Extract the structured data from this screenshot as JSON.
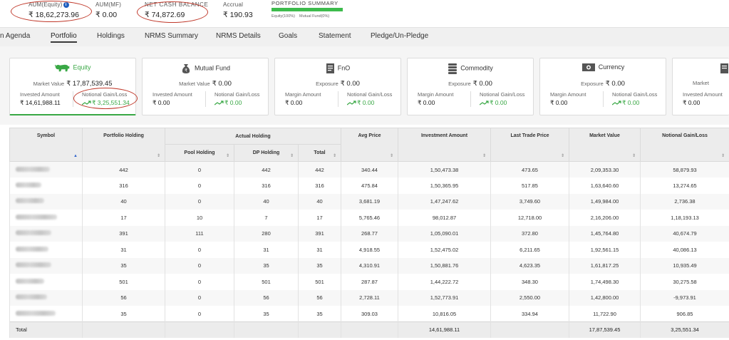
{
  "summary": {
    "aum_equity": {
      "label": "AUM(Equity)",
      "value": "₹ 18,62,273.96"
    },
    "aum_mf": {
      "label": "AUM(MF)",
      "value": "₹ 0.00"
    },
    "net_cash": {
      "label": "NET CASH BALANCE",
      "value": "₹ 74,872.69"
    },
    "accrual": {
      "label": "Accrual",
      "value": "₹ 190.93"
    },
    "portfolio_summary": {
      "title": "PORTFOLIO SUMMARY",
      "equity_pct": 100,
      "legend_equity": "Equity(100%)",
      "legend_mf": "Mutual Fund(0%)",
      "colors": {
        "equity": "#3dbb4c",
        "track": "#e5e5e5"
      }
    }
  },
  "nav": {
    "tabs": [
      "n Agenda",
      "Portfolio",
      "Holdings",
      "NRMS Summary",
      "NRMS Details",
      "Goals",
      "Statement",
      "Pledge/Un-Pledge"
    ],
    "active": "Portfolio"
  },
  "cards": [
    {
      "name": "Equity",
      "icon": "bull-icon",
      "sub_label": "Market Value",
      "sub_value": "₹ 17,87,539.45",
      "left_label": "Invested Amount",
      "left_value": "₹ 14,61,988.11",
      "right_label": "Notional Gain/Loss",
      "right_value": "₹ 3,25,551.34"
    },
    {
      "name": "Mutual Fund",
      "icon": "money-bag-icon",
      "sub_label": "Market Value",
      "sub_value": "₹ 0.00",
      "left_label": "Invested Amount",
      "left_value": "₹ 0.00",
      "right_label": "Notional Gain/Loss",
      "right_value": "₹ 0.00"
    },
    {
      "name": "FnO",
      "icon": "document-icon",
      "sub_label": "Exposure",
      "sub_value": "₹ 0.00",
      "left_label": "Margin Amount",
      "left_value": "₹ 0.00",
      "right_label": "Notional Gain/Loss",
      "right_value": "₹ 0.00"
    },
    {
      "name": "Commodity",
      "icon": "coin-stack-icon",
      "sub_label": "Exposure",
      "sub_value": "₹ 0.00",
      "left_label": "Margin Amount",
      "left_value": "₹ 0.00",
      "right_label": "Notional Gain/Loss",
      "right_value": "₹ 0.00"
    },
    {
      "name": "Currency",
      "icon": "banknote-icon",
      "sub_label": "Exposure",
      "sub_value": "₹ 0.00",
      "left_label": "Margin Amount",
      "left_value": "₹ 0.00",
      "right_label": "Notional Gain/Loss",
      "right_value": "₹ 0.00"
    },
    {
      "name": "Market",
      "icon": "document-icon",
      "sub_label": "",
      "sub_value": "",
      "left_label": "Invested Amount",
      "left_value": "₹ 0.00",
      "right_label": "",
      "right_value": ""
    }
  ],
  "table": {
    "headers": {
      "symbol": "Symbol",
      "portfolio_holding": "Portfolio Holding",
      "actual_holding": "Actual Holding",
      "pool_holding": "Pool Holding",
      "dp_holding": "DP Holding",
      "total": "Total",
      "avg_price": "Avg Price",
      "investment_amount": "Investment Amount",
      "last_trade_price": "Last Trade Price",
      "market_value": "Market Value",
      "notional_gain_loss": "Notional Gain/Loss"
    },
    "rows": [
      [
        "442",
        "0",
        "442",
        "442",
        "340.44",
        "1,50,473.38",
        "473.65",
        "2,09,353.30",
        "58,879.93"
      ],
      [
        "316",
        "0",
        "316",
        "316",
        "475.84",
        "1,50,365.95",
        "517.85",
        "1,63,640.60",
        "13,274.65"
      ],
      [
        "40",
        "0",
        "40",
        "40",
        "3,681.19",
        "1,47,247.62",
        "3,749.60",
        "1,49,984.00",
        "2,736.38"
      ],
      [
        "17",
        "10",
        "7",
        "17",
        "5,765.46",
        "98,012.87",
        "12,718.00",
        "2,16,206.00",
        "1,18,193.13"
      ],
      [
        "391",
        "111",
        "280",
        "391",
        "268.77",
        "1,05,090.01",
        "372.80",
        "1,45,764.80",
        "40,674.79"
      ],
      [
        "31",
        "0",
        "31",
        "31",
        "4,918.55",
        "1,52,475.02",
        "6,211.65",
        "1,92,561.15",
        "40,086.13"
      ],
      [
        "35",
        "0",
        "35",
        "35",
        "4,310.91",
        "1,50,881.76",
        "4,623.35",
        "1,61,817.25",
        "10,935.49"
      ],
      [
        "501",
        "0",
        "501",
        "501",
        "287.87",
        "1,44,222.72",
        "348.30",
        "1,74,498.30",
        "30,275.58"
      ],
      [
        "56",
        "0",
        "56",
        "56",
        "2,728.11",
        "1,52,773.91",
        "2,550.00",
        "1,42,800.00",
        "-9,973.91"
      ],
      [
        "35",
        "0",
        "35",
        "35",
        "309.03",
        "10,816.05",
        "334.94",
        "11,722.90",
        "906.85"
      ]
    ],
    "footer": {
      "label": "Total",
      "investment_amount": "14,61,988.11",
      "market_value": "17,87,539.45",
      "notional_gain_loss": "3,25,551.34"
    }
  }
}
